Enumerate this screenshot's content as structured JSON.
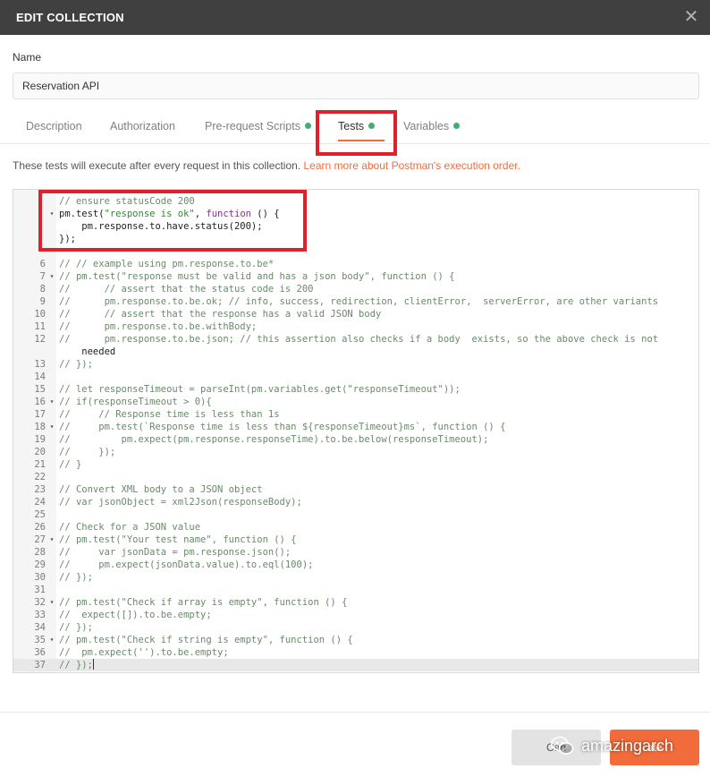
{
  "dialog": {
    "title": "EDIT COLLECTION",
    "close_icon": "close-icon"
  },
  "name_field": {
    "label": "Name",
    "value": "Reservation API"
  },
  "tabs": [
    {
      "label": "Description",
      "dot": false
    },
    {
      "label": "Authorization",
      "dot": false
    },
    {
      "label": "Pre-request Scripts",
      "dot": true
    },
    {
      "label": "Tests",
      "dot": true,
      "active": true
    },
    {
      "label": "Variables",
      "dot": true
    }
  ],
  "hint": {
    "text": "These tests will execute after every request in this collection.",
    "link": "Learn more about Postman's execution order."
  },
  "editor": {
    "lines": [
      {
        "n": "",
        "fold": false,
        "text": "// ensure statusCode 200"
      },
      {
        "n": "",
        "fold": true,
        "text": "pm.test(\"response is ok\", function () {"
      },
      {
        "n": "",
        "fold": false,
        "text": "    pm.response.to.have.status(200);"
      },
      {
        "n": "",
        "fold": false,
        "text": "});"
      },
      {
        "n": "",
        "fold": false,
        "text": ""
      },
      {
        "n": "6",
        "fold": false,
        "text": "// // example using pm.response.to.be*"
      },
      {
        "n": "7",
        "fold": true,
        "text": "// pm.test(\"response must be valid and has a json body\", function () {"
      },
      {
        "n": "8",
        "fold": false,
        "text": "//      // assert that the status code is 200"
      },
      {
        "n": "9",
        "fold": false,
        "text": "//      pm.response.to.be.ok; // info, success, redirection, clientError,  serverError, are other variants"
      },
      {
        "n": "10",
        "fold": false,
        "text": "//      // assert that the response has a valid JSON body"
      },
      {
        "n": "11",
        "fold": false,
        "text": "//      pm.response.to.be.withBody;"
      },
      {
        "n": "12",
        "fold": false,
        "text": "//      pm.response.to.be.json; // this assertion also checks if a body  exists, so the above check is not"
      },
      {
        "n": "",
        "fold": false,
        "text": "    needed"
      },
      {
        "n": "13",
        "fold": false,
        "text": "// });"
      },
      {
        "n": "14",
        "fold": false,
        "text": ""
      },
      {
        "n": "15",
        "fold": false,
        "text": "// let responseTimeout = parseInt(pm.variables.get(\"responseTimeout\"));"
      },
      {
        "n": "16",
        "fold": true,
        "text": "// if(responseTimeout > 0){"
      },
      {
        "n": "17",
        "fold": false,
        "text": "//     // Response time is less than 1s"
      },
      {
        "n": "18",
        "fold": true,
        "text": "//     pm.test(`Response time is less than ${responseTimeout}ms`, function () {"
      },
      {
        "n": "19",
        "fold": false,
        "text": "//         pm.expect(pm.response.responseTime).to.be.below(responseTimeout);"
      },
      {
        "n": "20",
        "fold": false,
        "text": "//     });"
      },
      {
        "n": "21",
        "fold": false,
        "text": "// }"
      },
      {
        "n": "22",
        "fold": false,
        "text": ""
      },
      {
        "n": "23",
        "fold": false,
        "text": "// Convert XML body to a JSON object"
      },
      {
        "n": "24",
        "fold": false,
        "text": "// var jsonObject = xml2Json(responseBody);"
      },
      {
        "n": "25",
        "fold": false,
        "text": ""
      },
      {
        "n": "26",
        "fold": false,
        "text": "// Check for a JSON value"
      },
      {
        "n": "27",
        "fold": true,
        "text": "// pm.test(\"Your test name\", function () {"
      },
      {
        "n": "28",
        "fold": false,
        "text": "//     var jsonData = pm.response.json();"
      },
      {
        "n": "29",
        "fold": false,
        "text": "//     pm.expect(jsonData.value).to.eql(100);"
      },
      {
        "n": "30",
        "fold": false,
        "text": "// });"
      },
      {
        "n": "31",
        "fold": false,
        "text": ""
      },
      {
        "n": "32",
        "fold": true,
        "text": "// pm.test(\"Check if array is empty\", function () {"
      },
      {
        "n": "33",
        "fold": false,
        "text": "//  expect([]).to.be.empty;"
      },
      {
        "n": "34",
        "fold": false,
        "text": "// });"
      },
      {
        "n": "35",
        "fold": true,
        "text": "// pm.test(\"Check if string is empty\", function () {"
      },
      {
        "n": "36",
        "fold": false,
        "text": "//  pm.expect('').to.be.empty;"
      },
      {
        "n": "37",
        "fold": false,
        "text": "// });"
      }
    ]
  },
  "footer": {
    "cancel_label": "Can",
    "update_label": "ate"
  },
  "watermark": {
    "text": "amazingarch",
    "icon": "wechat-icon"
  },
  "colors": {
    "accent": "#f26b3a",
    "highlight_border": "#e0202b",
    "status_dot": "#3bb273",
    "titlebar": "#404040"
  }
}
